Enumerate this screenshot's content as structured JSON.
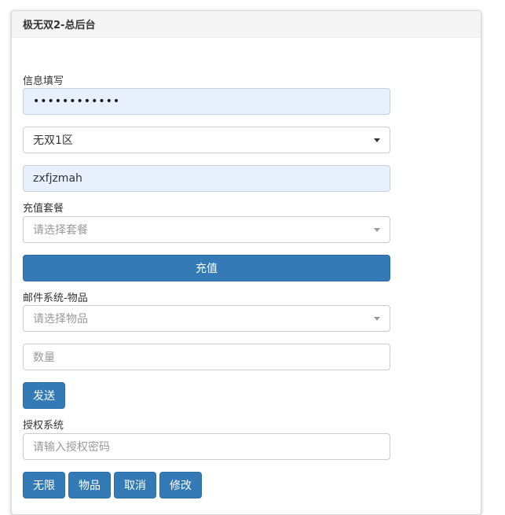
{
  "panel": {
    "title": "极无双2-总后台"
  },
  "info_section": {
    "label": "信息填写",
    "password_value": "••••••••••••",
    "server_select_value": "无双1区",
    "account_value": "zxfjzmah"
  },
  "recharge_section": {
    "label": "充值套餐",
    "package_placeholder": "请选择套餐",
    "recharge_button": "充值"
  },
  "mail_section": {
    "label": "邮件系统-物品",
    "item_placeholder": "请选择物品",
    "quantity_placeholder": "数量",
    "send_button": "发送"
  },
  "auth_section": {
    "label": "授权系统",
    "password_placeholder": "请输入授权密码",
    "buttons": [
      "无限",
      "物品",
      "取消",
      "修改"
    ]
  },
  "colors": {
    "primary": "#337ab7",
    "autofill_bg": "#e8f0fe",
    "heading_bg": "#f5f5f5"
  }
}
